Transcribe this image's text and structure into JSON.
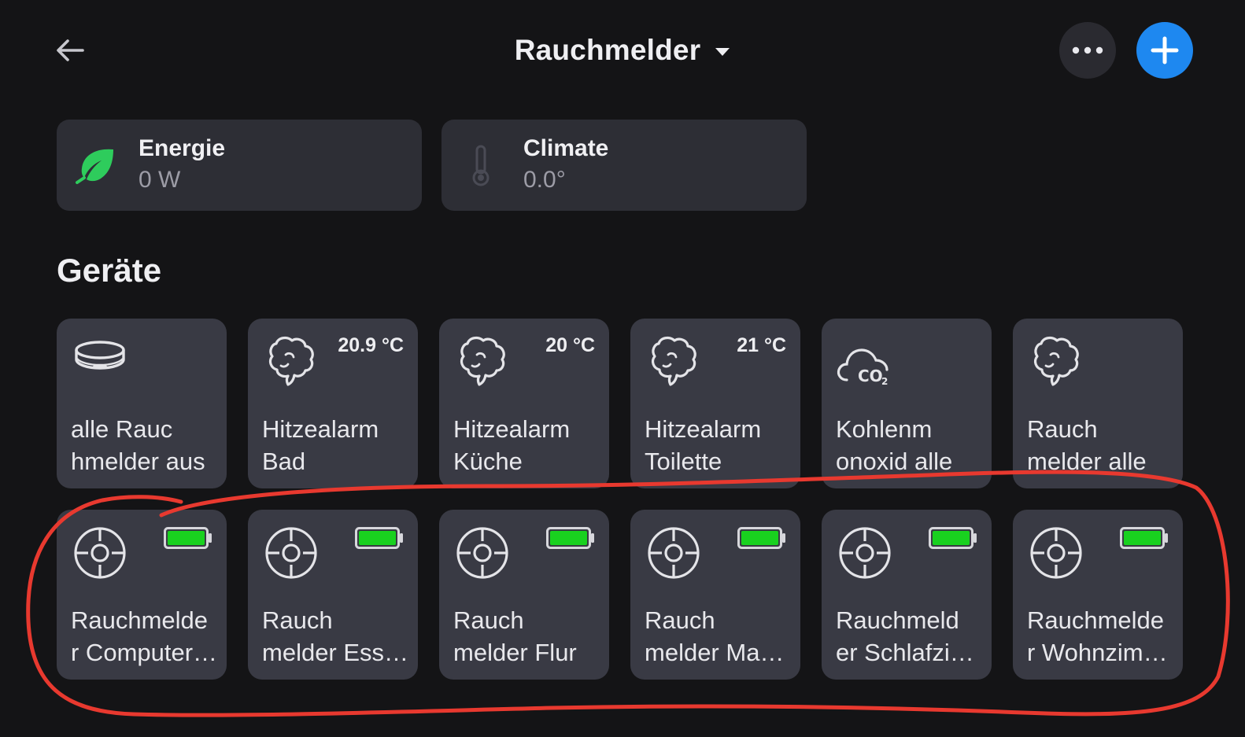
{
  "header": {
    "title": "Rauchmelder"
  },
  "summary": {
    "energy": {
      "label": "Energie",
      "value": "0 W"
    },
    "climate": {
      "label": "Climate",
      "value": "0.0°"
    }
  },
  "section": {
    "title": "Geräte"
  },
  "devices_row1": [
    {
      "icon": "smoke-detector-icon",
      "line1": "alle Rauc",
      "line2": "hmelder aus",
      "temp": ""
    },
    {
      "icon": "smoke-cloud-icon",
      "line1": "Hitzealarm",
      "line2": "Bad",
      "temp": "20.9 °C"
    },
    {
      "icon": "smoke-cloud-icon",
      "line1": "Hitzealarm",
      "line2": "Küche",
      "temp": "20 °C"
    },
    {
      "icon": "smoke-cloud-icon",
      "line1": "Hitzealarm",
      "line2": "Toilette",
      "temp": "21 °C"
    },
    {
      "icon": "co2-cloud-icon",
      "line1": "Kohlenm",
      "line2": "onoxid alle",
      "temp": ""
    },
    {
      "icon": "smoke-cloud-icon",
      "line1": "Rauch",
      "line2": "melder alle",
      "temp": ""
    }
  ],
  "devices_row2": [
    {
      "icon": "smoke-sensor-icon",
      "line1": "Rauchmelde",
      "line2": "r Computer…",
      "battery": "full"
    },
    {
      "icon": "smoke-sensor-icon",
      "line1": "Rauch",
      "line2": "melder Ess…",
      "battery": "full"
    },
    {
      "icon": "smoke-sensor-icon",
      "line1": "Rauch",
      "line2": "melder Flur",
      "battery": "full"
    },
    {
      "icon": "smoke-sensor-icon",
      "line1": "Rauch",
      "line2": "melder Ma…",
      "battery": "full"
    },
    {
      "icon": "smoke-sensor-icon",
      "line1": "Rauchmeld",
      "line2": "er Schlafzi…",
      "battery": "full"
    },
    {
      "icon": "smoke-sensor-icon",
      "line1": "Rauchmelde",
      "line2": "r Wohnzim…",
      "battery": "full"
    }
  ],
  "colors": {
    "background": "#141416",
    "card": "#2d2e35",
    "tile": "#393a44",
    "accent": "#1e88f0",
    "energy_leaf": "#2ecc5c",
    "battery": "#19d11f",
    "annotation": "#e8392f"
  }
}
